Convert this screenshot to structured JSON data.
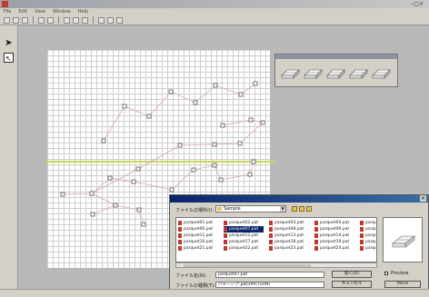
{
  "app": {
    "title": "",
    "menus": [
      "File",
      "Edit",
      "View",
      "Window",
      "Help"
    ]
  },
  "tools": {
    "select_icon": "arrow-pointer",
    "node_icon": "node-pointer"
  },
  "palette": {
    "tile_count": 5,
    "tile_icon": "parquet-tile"
  },
  "dialog": {
    "title": "",
    "look_in_label": "ファイルの場所(I):",
    "look_in_value": "Sample",
    "files": [
      "parquet01.pat",
      "parquet06.pat",
      "parquet11.pat",
      "parquet16.pat",
      "parquet21.pat",
      "parquet02.pat",
      "parquet07.pat",
      "parquet12.pat",
      "parquet17.pat",
      "parquet22.pat",
      "parquet03.pat",
      "parquet08.pat",
      "parquet13.pat",
      "parquet18.pat",
      "parquet23.pat",
      "parquet04.pat",
      "parquet09.pat",
      "parquet14.pat",
      "parquet19.pat",
      "parquet24.pat",
      "parquet05.pat",
      "parquet10.pat",
      "parquet15.pat",
      "parquet20.pat",
      "parquet25.pat"
    ],
    "selected_file": "parquet07.pat",
    "filename_label": "ファイル名(N):",
    "filename_value": "parquet07.pat",
    "filetype_label": "ファイルの種類(T):",
    "filetype_value": "パターン (*.pat)(PATTERN)",
    "open_button": "開く(O)",
    "cancel_button": "キャンセル",
    "preview_label": "Preview",
    "help_button": "Parse"
  },
  "status": {
    "text": ""
  },
  "colors": {
    "sheet_grid": "#cfcfcf",
    "generator_line": "#c9d65a",
    "segment": "#d9a5b5",
    "selection": "#0a246a"
  }
}
